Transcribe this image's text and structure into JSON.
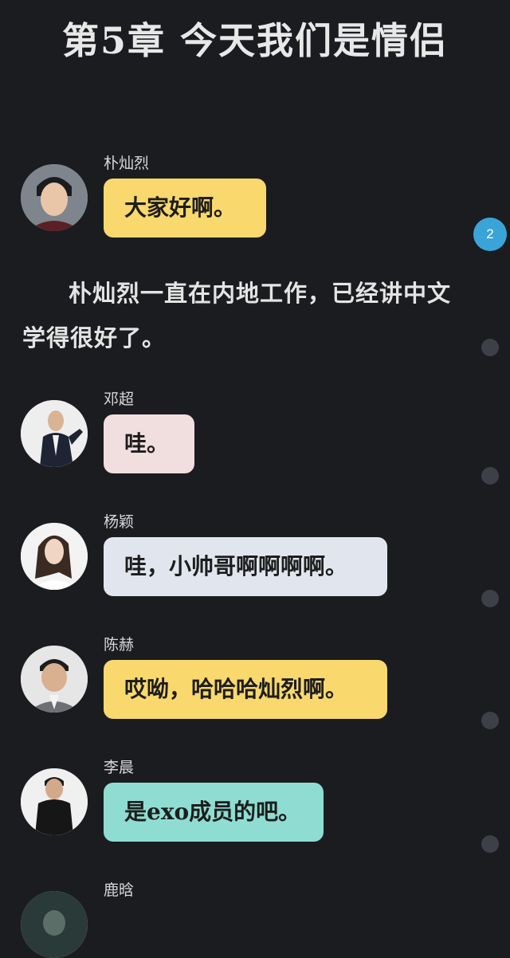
{
  "chapter": {
    "title": "第5章 今天我们是情侣"
  },
  "narration": "朴灿烈一直在内地工作，已经讲中文学得很好了。",
  "comment_badge": "2",
  "messages": [
    {
      "name": "朴灿烈",
      "text": "大家好啊。",
      "bubble_color": "#f9d86e"
    },
    {
      "name": "邓超",
      "text": "哇。",
      "bubble_color": "#f1dede"
    },
    {
      "name": "杨颖",
      "text": "哇，小帅哥啊啊啊啊。",
      "bubble_color": "#e1e6ee"
    },
    {
      "name": "陈赫",
      "text": "哎呦，哈哈哈灿烈啊。",
      "bubble_color": "#f9d86e"
    },
    {
      "name": "李晨",
      "text": "是exo成员的吧。",
      "bubble_color": "#8fddd2"
    },
    {
      "name": "鹿晗",
      "text": "",
      "bubble_color": ""
    }
  ]
}
